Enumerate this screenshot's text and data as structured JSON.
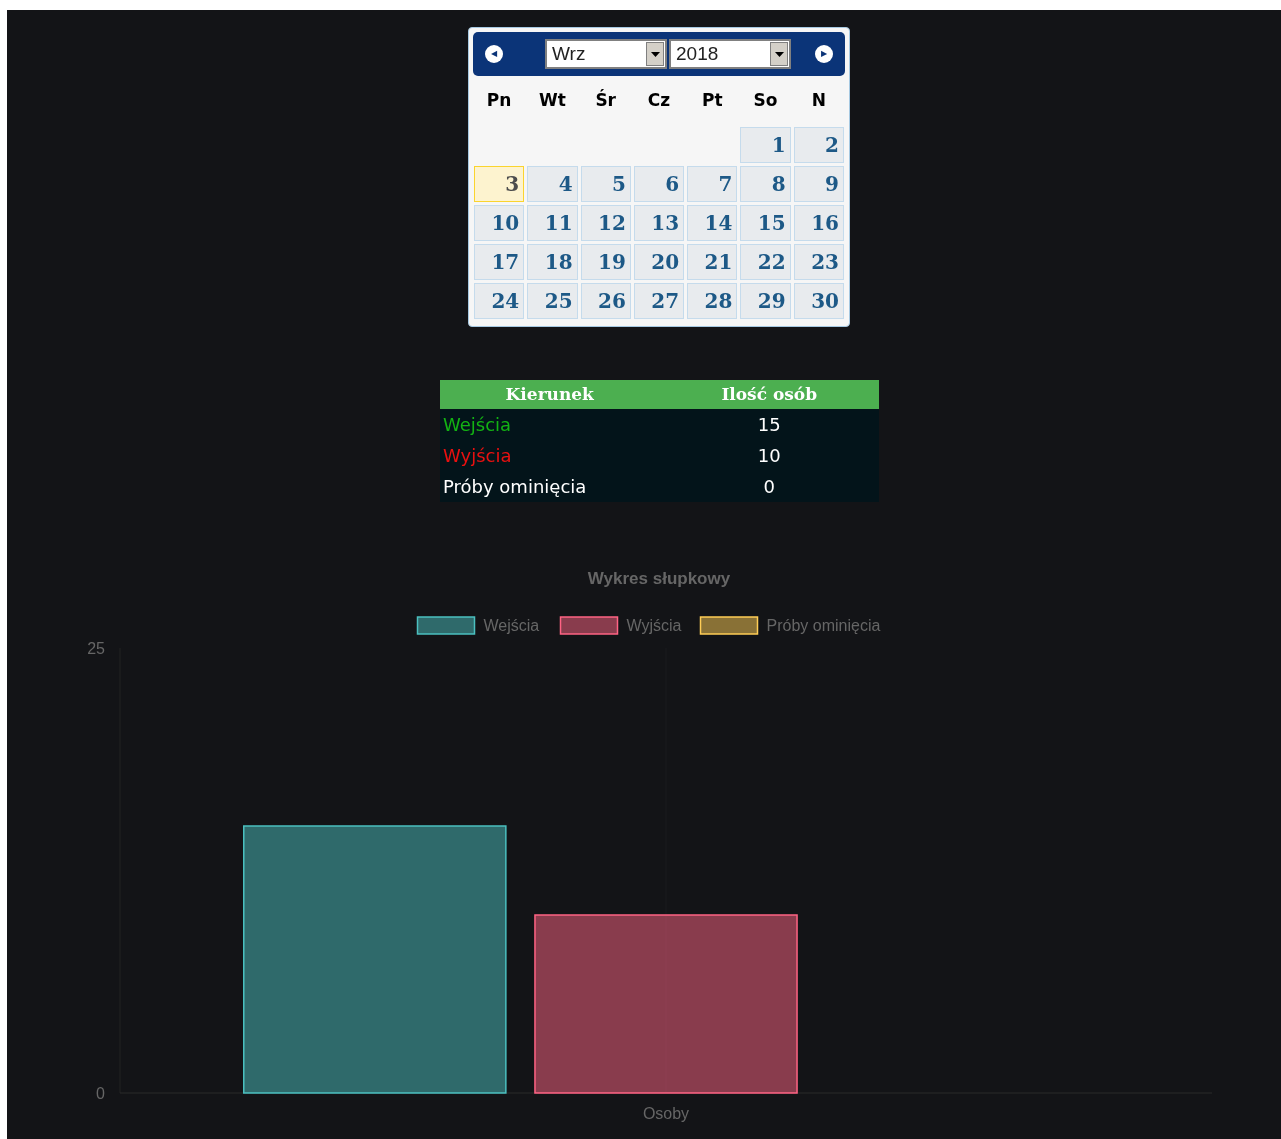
{
  "calendar": {
    "prev": "◀",
    "next": "▶",
    "month": "Wrz",
    "year": "2018",
    "weekdays": [
      "Pn",
      "Wt",
      "Śr",
      "Cz",
      "Pt",
      "So",
      "N"
    ],
    "weeks": [
      [
        {
          "day": "1",
          "selected": false
        },
        {
          "day": "2",
          "selected": false
        }
      ],
      [
        {
          "day": "3",
          "selected": true
        },
        {
          "day": "4",
          "selected": false
        },
        {
          "day": "5",
          "selected": false
        },
        {
          "day": "6",
          "selected": false
        },
        {
          "day": "7",
          "selected": false
        },
        {
          "day": "8",
          "selected": false
        },
        {
          "day": "9",
          "selected": false
        }
      ],
      [
        {
          "day": "10",
          "selected": false
        },
        {
          "day": "11",
          "selected": false
        },
        {
          "day": "12",
          "selected": false
        },
        {
          "day": "13",
          "selected": false
        },
        {
          "day": "14",
          "selected": false
        },
        {
          "day": "15",
          "selected": false
        },
        {
          "day": "16",
          "selected": false
        }
      ],
      [
        {
          "day": "17",
          "selected": false
        },
        {
          "day": "18",
          "selected": false
        },
        {
          "day": "19",
          "selected": false
        },
        {
          "day": "20",
          "selected": false
        },
        {
          "day": "21",
          "selected": false
        },
        {
          "day": "22",
          "selected": false
        },
        {
          "day": "23",
          "selected": false
        }
      ],
      [
        {
          "day": "24",
          "selected": false
        },
        {
          "day": "25",
          "selected": false
        },
        {
          "day": "26",
          "selected": false
        },
        {
          "day": "27",
          "selected": false
        },
        {
          "day": "28",
          "selected": false
        },
        {
          "day": "29",
          "selected": false
        },
        {
          "day": "30",
          "selected": false
        }
      ]
    ]
  },
  "table": {
    "columns": [
      "Kierunek",
      "Ilość osób"
    ],
    "rows": [
      {
        "label": "Wejścia",
        "value": "15",
        "color": "#13b213"
      },
      {
        "label": "Wyjścia",
        "value": "10",
        "color": "#e81010"
      },
      {
        "label": "Próby ominięcia",
        "value": "0",
        "color": "#ffffff"
      }
    ]
  },
  "chart_data": {
    "type": "bar",
    "title": "Wykres słupkowy",
    "categories": [
      "Osoby"
    ],
    "series": [
      {
        "name": "Wejścia",
        "color": "#4bc0c0",
        "values": [
          15
        ]
      },
      {
        "name": "Wyjścia",
        "color": "#ff6384",
        "values": [
          10
        ]
      },
      {
        "name": "Próby ominięcia",
        "color": "#ffcd56",
        "values": [
          0
        ]
      }
    ],
    "ylim": [
      0,
      25
    ],
    "yticks": [
      0,
      25
    ],
    "legend": true
  }
}
